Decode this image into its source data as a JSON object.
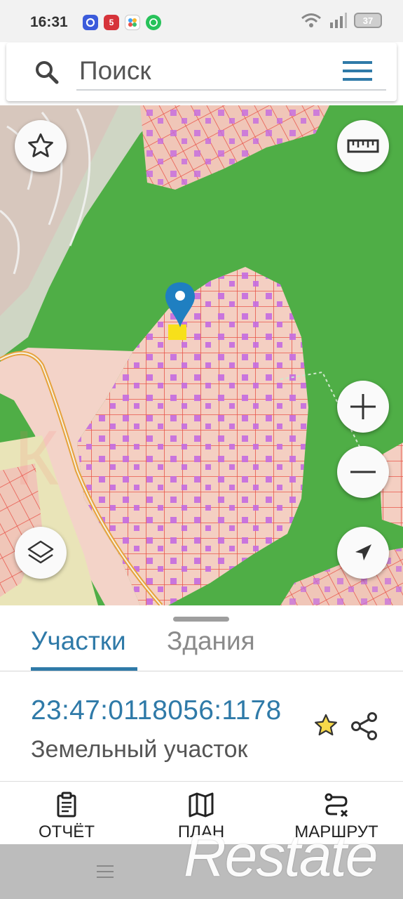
{
  "status_bar": {
    "time": "16:31",
    "battery": "37",
    "app_icons": [
      "messenger-icon",
      "pyaterochka-icon",
      "gallery-icon",
      "whatsapp-icon"
    ]
  },
  "search": {
    "placeholder": "Поиск"
  },
  "map": {
    "colors": {
      "forest": "#4fae46",
      "parcel_fill": "#f4cfc2",
      "parcel_border": "#e8554a",
      "building": "#c46be0",
      "marker": "#1f7fc1",
      "selected": "#f7e01a"
    },
    "controls": [
      "favorites-star-icon",
      "ruler-icon",
      "zoom-in-icon",
      "zoom-out-icon",
      "layers-icon",
      "my-location-icon"
    ]
  },
  "sheet": {
    "tabs": [
      "Участки",
      "Здания"
    ],
    "active_tab": "Участки",
    "result": {
      "cadastral_number": "23:47:0118056:1178",
      "type": "Земельный участок"
    }
  },
  "actions": [
    {
      "label": "ОТЧЁТ",
      "icon": "clipboard-icon"
    },
    {
      "label": "ПЛАН",
      "icon": "map-icon"
    },
    {
      "label": "МАРШРУТ",
      "icon": "route-icon"
    }
  ],
  "watermark": "Restate"
}
